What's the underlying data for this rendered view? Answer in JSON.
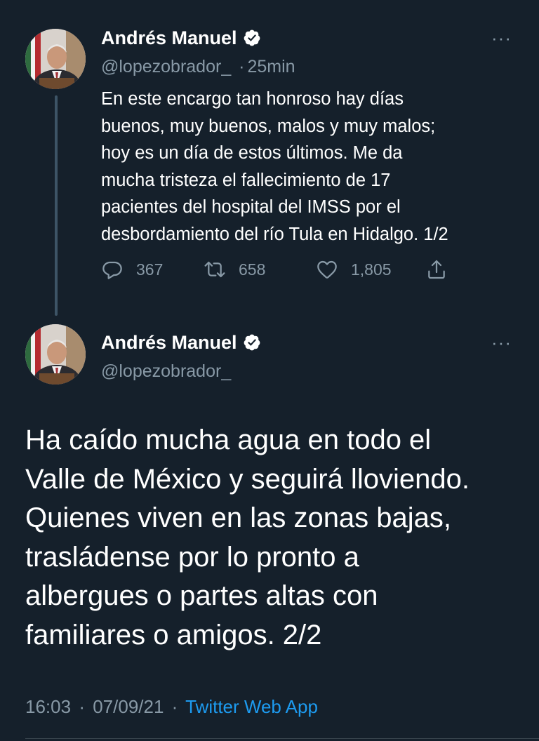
{
  "tweets": [
    {
      "name": "Andrés Manuel",
      "handle": "@lopezobrador_",
      "separator": "·",
      "time": "25min",
      "text_lines": [
        "En este encargo tan honroso hay días",
        "buenos, muy buenos, malos y muy malos;",
        "hoy es un día de estos últimos. Me da",
        "mucha tristeza el fallecimiento de 17",
        "pacientes del hospital del IMSS por el",
        "desbordamiento del río Tula en Hidalgo. 1/2"
      ],
      "replies": "367",
      "retweets": "658",
      "likes": "1,805",
      "more": "···"
    },
    {
      "name": "Andrés Manuel",
      "handle": "@lopezobrador_",
      "text_lines": [
        "Ha caído mucha agua en todo el",
        "Valle de México y seguirá lloviendo.",
        "Quienes viven en las zonas bajas,",
        "trasládense por lo pronto a",
        "albergues o partes altas con",
        "familiares o amigos. 2/2"
      ],
      "more": "···",
      "time": "16:03",
      "separator": "·",
      "date": "07/09/21",
      "source": "Twitter Web App"
    }
  ],
  "icons": {
    "verified": "verified-badge-icon",
    "reply": "reply-icon",
    "retweet": "retweet-icon",
    "like": "heart-icon",
    "share": "share-icon",
    "more": "more-options-icon"
  },
  "colors": {
    "background": "#15202b",
    "secondary_text": "#8899a6",
    "link": "#1d9bf0",
    "thread_line": "#3d5466"
  }
}
